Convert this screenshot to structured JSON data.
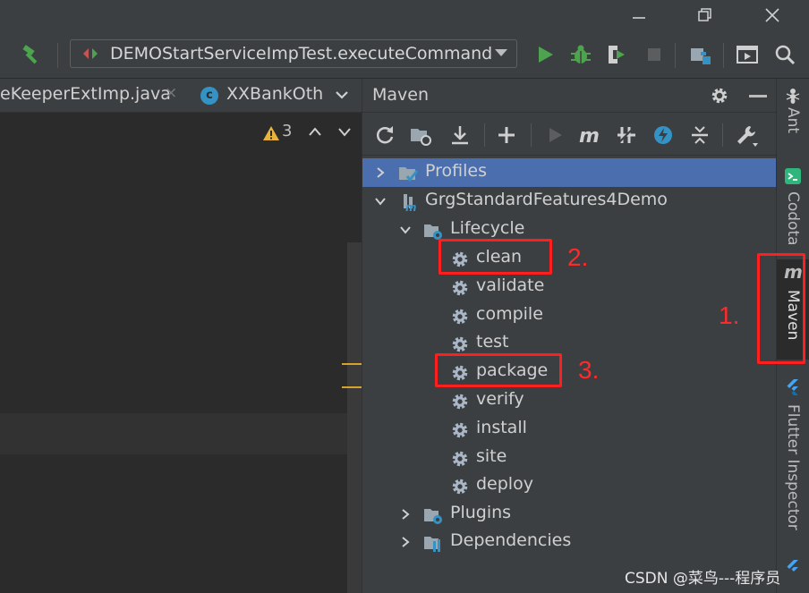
{
  "titlebar": {
    "minimize_icon": "minimize-icon",
    "restore_icon": "restore-icon",
    "close_icon": "close-icon"
  },
  "toolbar": {
    "build_icon": "hammer-icon",
    "run_config_label": "DEMOStartServiceImpTest.executeCommand",
    "run_icon": "run-icon",
    "debug_icon": "debug-icon",
    "coverage_icon": "coverage-icon",
    "stop_icon": "stop-icon",
    "project_structure_icon": "project-structure-icon",
    "presentation_icon": "presentation-icon",
    "search_icon": "search-icon"
  },
  "editor_tabs": [
    {
      "label": "eKeeperExtImp.java"
    },
    {
      "label": "XXBankOth",
      "icon_letter": "c"
    }
  ],
  "editor": {
    "warning_count": "3"
  },
  "maven": {
    "title": "Maven",
    "tree": {
      "profiles": "Profiles",
      "project": "GrgStandardFeatures4Demo",
      "lifecycle": "Lifecycle",
      "phases": [
        "clean",
        "validate",
        "compile",
        "test",
        "package",
        "verify",
        "install",
        "site",
        "deploy"
      ],
      "plugins": "Plugins",
      "dependencies": "Dependencies"
    }
  },
  "tool_strip": {
    "ant": "Ant",
    "codota": "Codota",
    "maven": "Maven",
    "flutter": "Flutter Inspector",
    "maven_glyph": "m"
  },
  "annotations": {
    "one": "1.",
    "two": "2.",
    "three": "3."
  },
  "watermark": "CSDN @菜鸟---程序员",
  "colors": {
    "background": "#2b2b2b",
    "panel": "#3c3f41",
    "selection": "#4b6eaf",
    "annotation": "#ff1f1f",
    "run_green": "#4ea34e"
  }
}
